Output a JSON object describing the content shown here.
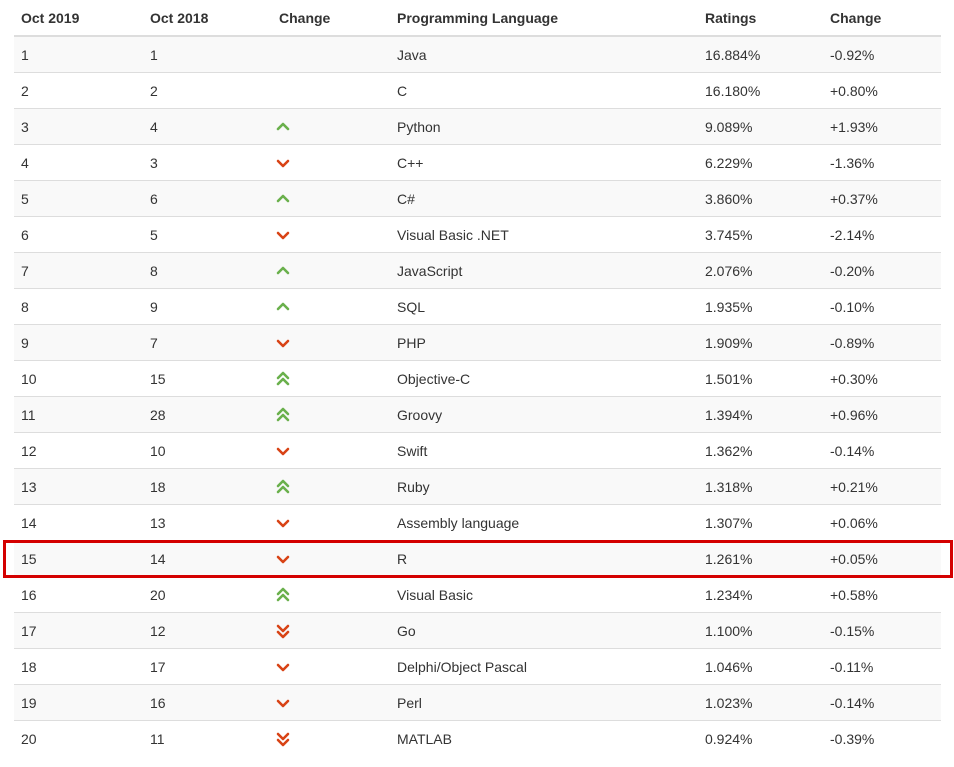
{
  "colors": {
    "up": "#6ab04c",
    "down": "#d84315",
    "highlight": "#d40000"
  },
  "headers": [
    "Oct 2019",
    "Oct 2018",
    "Change",
    "Programming Language",
    "Ratings",
    "Change"
  ],
  "rows": [
    {
      "rank_2019": "1",
      "rank_2018": "1",
      "trend": "none",
      "language": "Java",
      "rating": "16.884%",
      "change": "-0.92%"
    },
    {
      "rank_2019": "2",
      "rank_2018": "2",
      "trend": "none",
      "language": "C",
      "rating": "16.180%",
      "change": "+0.80%"
    },
    {
      "rank_2019": "3",
      "rank_2018": "4",
      "trend": "up",
      "language": "Python",
      "rating": "9.089%",
      "change": "+1.93%"
    },
    {
      "rank_2019": "4",
      "rank_2018": "3",
      "trend": "down",
      "language": "C++",
      "rating": "6.229%",
      "change": "-1.36%"
    },
    {
      "rank_2019": "5",
      "rank_2018": "6",
      "trend": "up",
      "language": "C#",
      "rating": "3.860%",
      "change": "+0.37%"
    },
    {
      "rank_2019": "6",
      "rank_2018": "5",
      "trend": "down",
      "language": "Visual Basic .NET",
      "rating": "3.745%",
      "change": "-2.14%"
    },
    {
      "rank_2019": "7",
      "rank_2018": "8",
      "trend": "up",
      "language": "JavaScript",
      "rating": "2.076%",
      "change": "-0.20%"
    },
    {
      "rank_2019": "8",
      "rank_2018": "9",
      "trend": "up",
      "language": "SQL",
      "rating": "1.935%",
      "change": "-0.10%"
    },
    {
      "rank_2019": "9",
      "rank_2018": "7",
      "trend": "down",
      "language": "PHP",
      "rating": "1.909%",
      "change": "-0.89%"
    },
    {
      "rank_2019": "10",
      "rank_2018": "15",
      "trend": "double-up",
      "language": "Objective-C",
      "rating": "1.501%",
      "change": "+0.30%"
    },
    {
      "rank_2019": "11",
      "rank_2018": "28",
      "trend": "double-up",
      "language": "Groovy",
      "rating": "1.394%",
      "change": "+0.96%"
    },
    {
      "rank_2019": "12",
      "rank_2018": "10",
      "trend": "down",
      "language": "Swift",
      "rating": "1.362%",
      "change": "-0.14%"
    },
    {
      "rank_2019": "13",
      "rank_2018": "18",
      "trend": "double-up",
      "language": "Ruby",
      "rating": "1.318%",
      "change": "+0.21%"
    },
    {
      "rank_2019": "14",
      "rank_2018": "13",
      "trend": "down",
      "language": "Assembly language",
      "rating": "1.307%",
      "change": "+0.06%"
    },
    {
      "rank_2019": "15",
      "rank_2018": "14",
      "trend": "down",
      "language": "R",
      "rating": "1.261%",
      "change": "+0.05%",
      "highlighted": true
    },
    {
      "rank_2019": "16",
      "rank_2018": "20",
      "trend": "double-up",
      "language": "Visual Basic",
      "rating": "1.234%",
      "change": "+0.58%"
    },
    {
      "rank_2019": "17",
      "rank_2018": "12",
      "trend": "double-down",
      "language": "Go",
      "rating": "1.100%",
      "change": "-0.15%"
    },
    {
      "rank_2019": "18",
      "rank_2018": "17",
      "trend": "down",
      "language": "Delphi/Object Pascal",
      "rating": "1.046%",
      "change": "-0.11%"
    },
    {
      "rank_2019": "19",
      "rank_2018": "16",
      "trend": "down",
      "language": "Perl",
      "rating": "1.023%",
      "change": "-0.14%"
    },
    {
      "rank_2019": "20",
      "rank_2018": "11",
      "trend": "double-down",
      "language": "MATLAB",
      "rating": "0.924%",
      "change": "-0.39%"
    }
  ]
}
